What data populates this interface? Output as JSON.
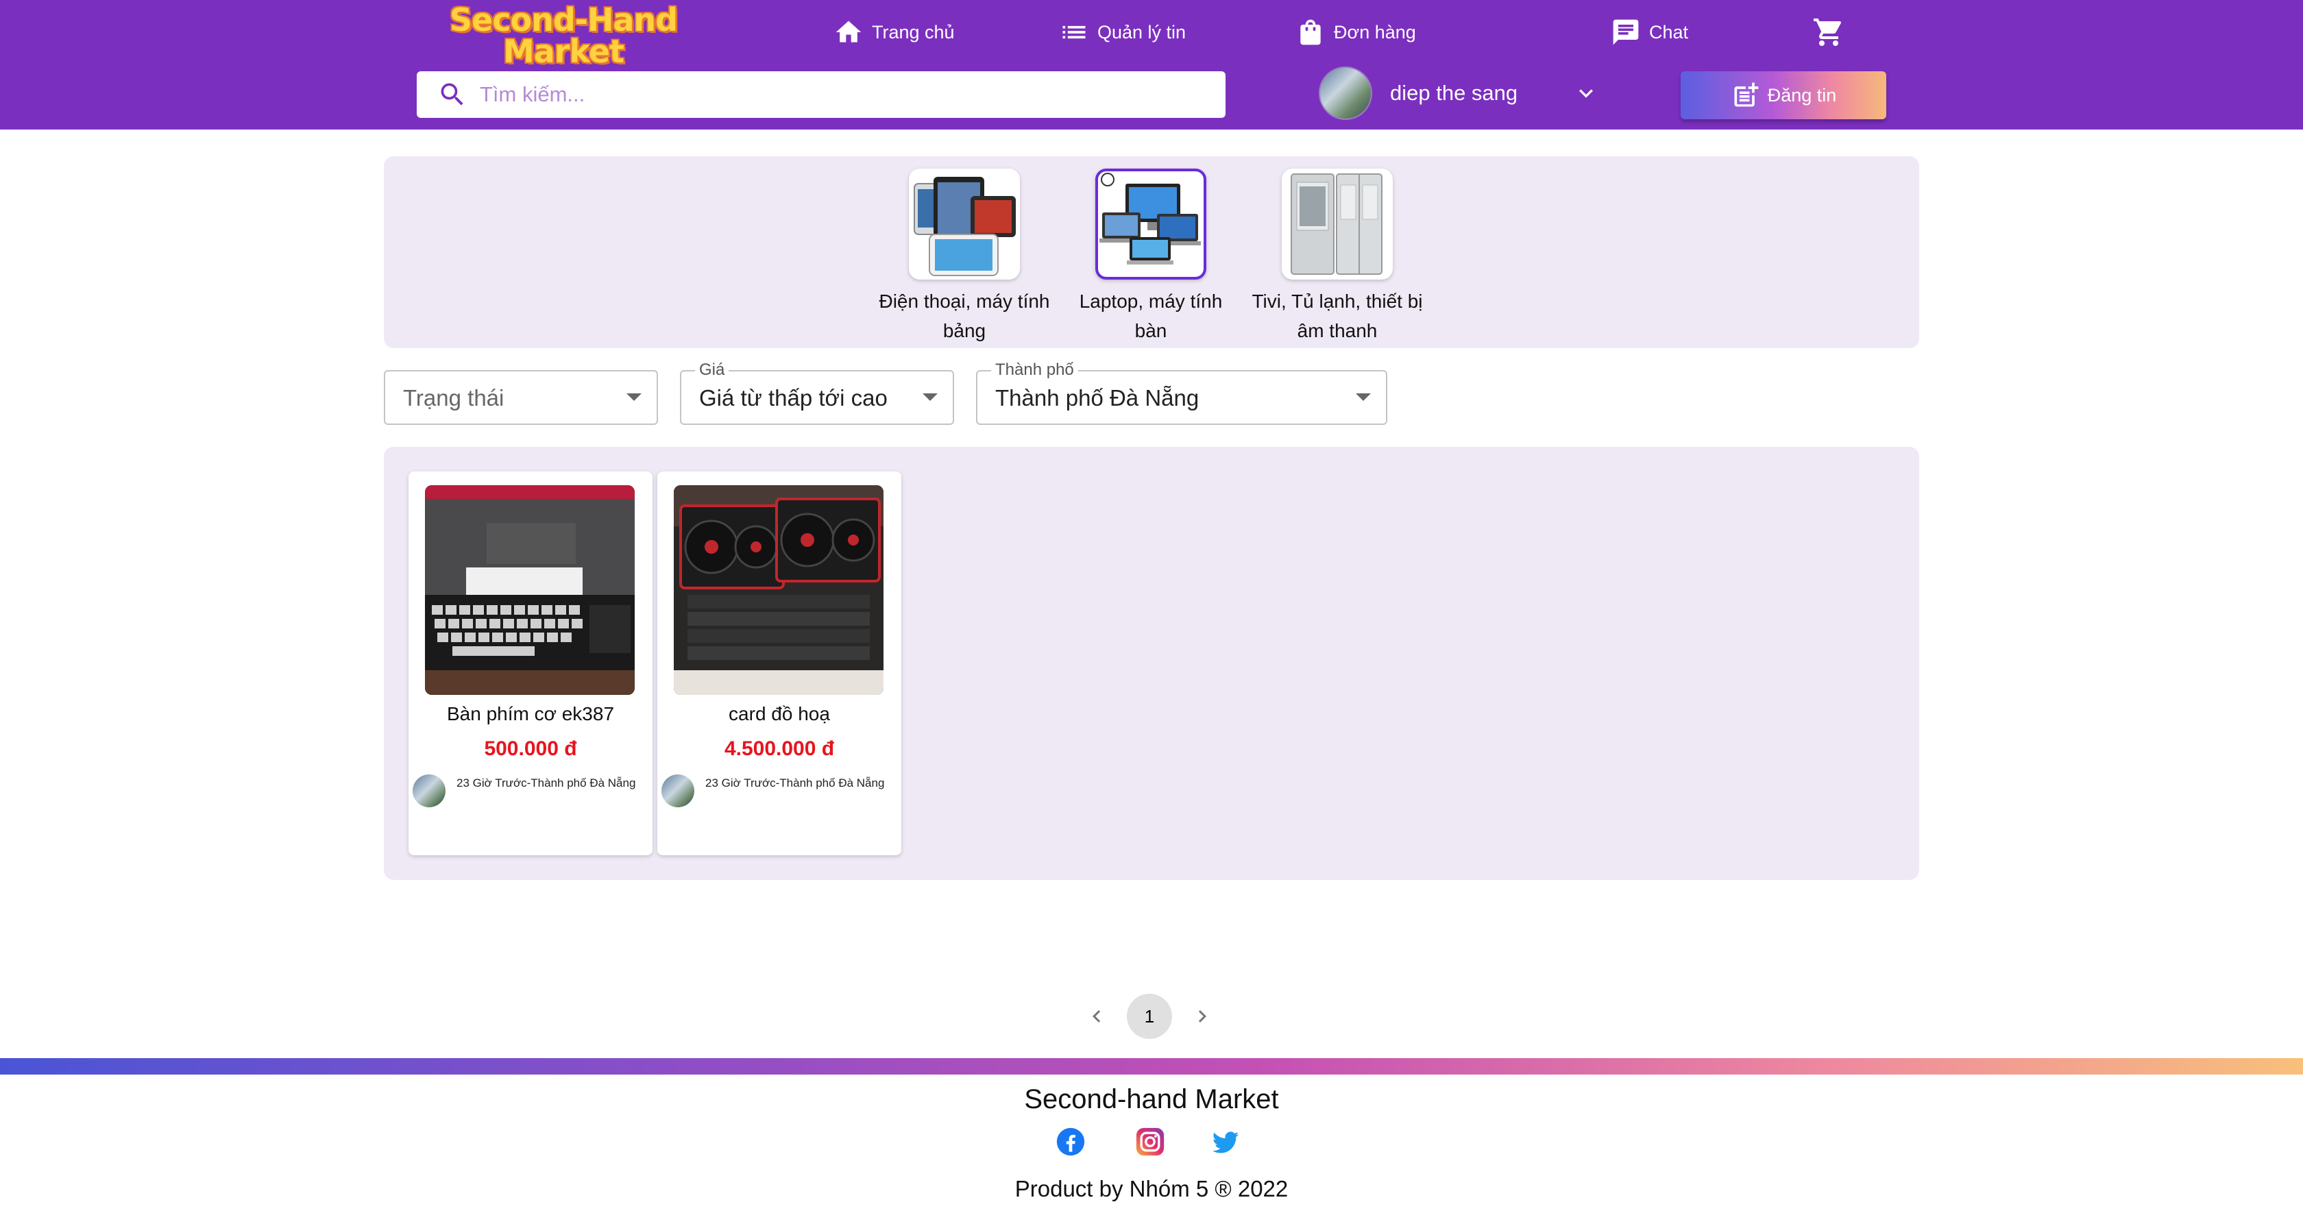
{
  "header": {
    "logo_line1": "Second-Hand",
    "logo_line2": "Market",
    "nav": {
      "home": "Trang chủ",
      "manage": "Quản lý tin",
      "orders": "Đơn hàng",
      "chat": "Chat"
    },
    "search_placeholder": "Tìm kiếm...",
    "user_name": "diep the sang",
    "post_button": "Đăng tin"
  },
  "categories": [
    {
      "label": "Điện thoại, máy tính bảng",
      "selected": false
    },
    {
      "label": "Laptop, máy tính bàn",
      "selected": true
    },
    {
      "label": "Tivi, Tủ lạnh, thiết bị âm thanh",
      "selected": false
    }
  ],
  "filters": {
    "status": {
      "value": "Trạng thái"
    },
    "price": {
      "legend": "Giá",
      "value": "Giá từ thấp tới cao"
    },
    "city": {
      "legend": "Thành phố",
      "value": "Thành phố Đà Nẵng"
    }
  },
  "listings": [
    {
      "title": "Bàn phím cơ ek387",
      "price": "500.000 đ",
      "meta": "23 Giờ Trước-Thành phố Đà Nẵng"
    },
    {
      "title": "card đồ hoạ",
      "price": "4.500.000 đ",
      "meta": "23 Giờ Trước-Thành phố Đà Nẵng"
    }
  ],
  "pagination": {
    "current": "1"
  },
  "footer": {
    "title": "Second-hand Market",
    "credit": "Product by Nhóm 5 ® 2022"
  },
  "colors": {
    "brand_purple": "#7b2fbe",
    "price_red": "#e8141e",
    "panel_bg": "#efe9f5"
  }
}
